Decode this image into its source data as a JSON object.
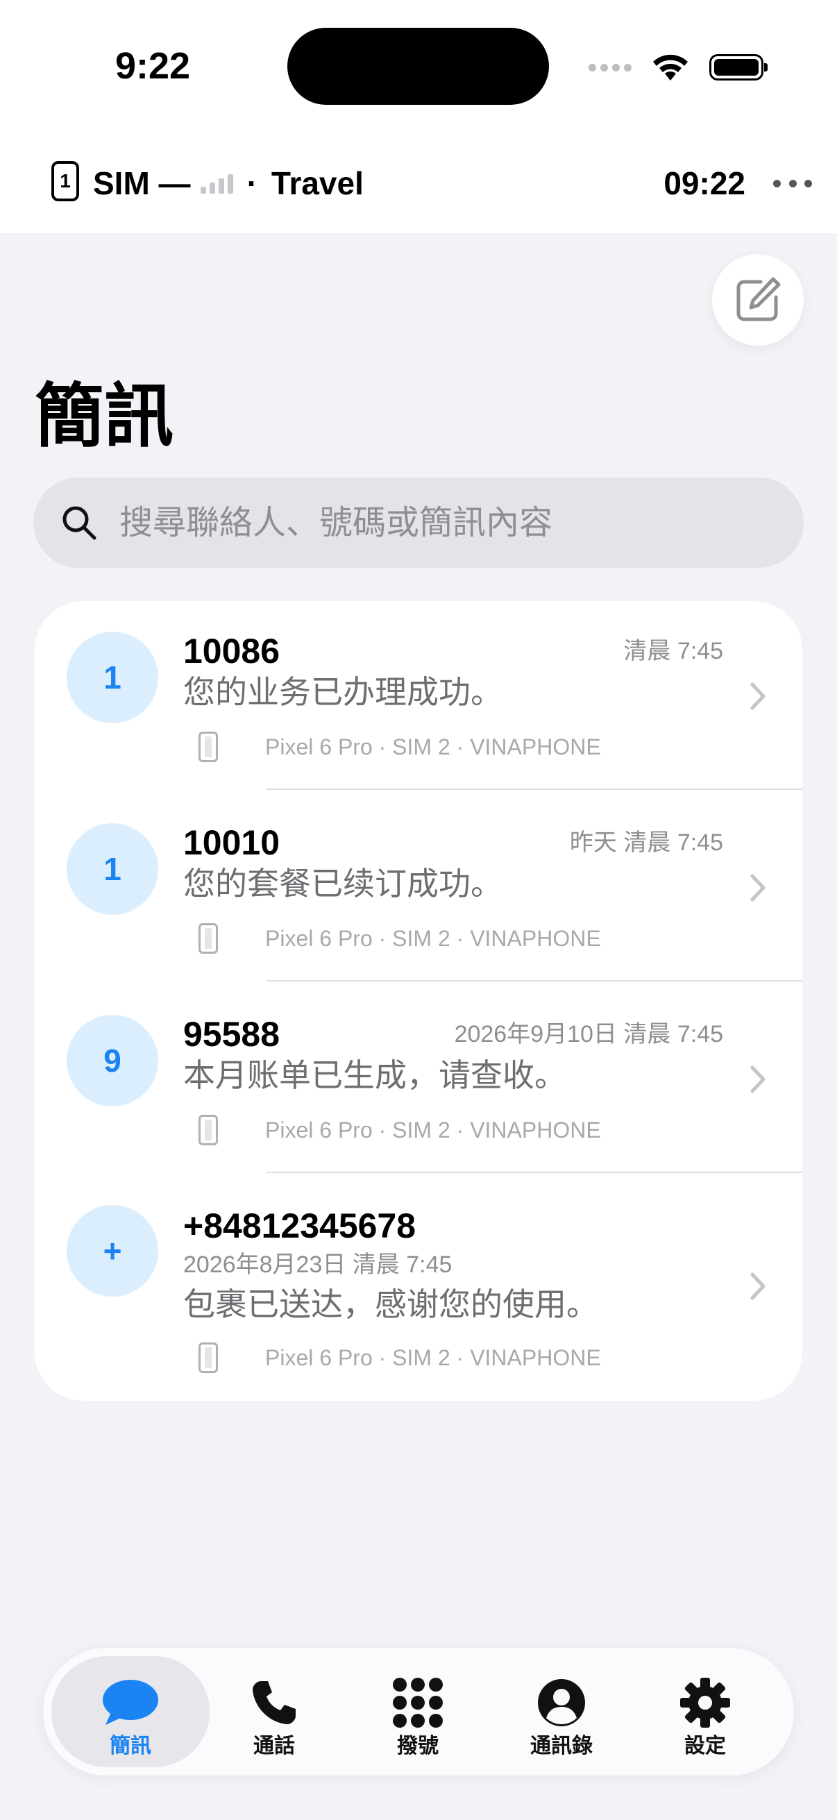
{
  "status_bar": {
    "time": "9:22"
  },
  "sim_bar": {
    "sim_slot": "1",
    "text": "SIM —",
    "dot": "·",
    "carrier": "Travel",
    "time": "09:22"
  },
  "header": {
    "title": "簡訊"
  },
  "search": {
    "placeholder": "搜尋聯絡人、號碼或簡訊內容"
  },
  "messages": [
    {
      "avatar": "1",
      "sender": "10086",
      "time": "清晨 7:45",
      "preview": "您的业务已办理成功。",
      "meta": "Pixel 6 Pro · SIM 2 · VINAPHONE"
    },
    {
      "avatar": "1",
      "sender": "10010",
      "time": "昨天 清晨 7:45",
      "preview": "您的套餐已续订成功。",
      "meta": "Pixel 6 Pro · SIM 2 · VINAPHONE"
    },
    {
      "avatar": "9",
      "sender": "95588",
      "time": "2026年9月10日 清晨 7:45",
      "preview": "本月账单已生成，请查收。",
      "meta": "Pixel 6 Pro · SIM 2 · VINAPHONE"
    },
    {
      "avatar": "+",
      "sender": "+84812345678",
      "time": "2026年8月23日 清晨 7:45",
      "preview": "包裹已送达，感谢您的使用。",
      "meta": "Pixel 6 Pro · SIM 2 · VINAPHONE"
    }
  ],
  "tabs": [
    {
      "label": "簡訊",
      "icon": "message-bubble-icon",
      "active": true
    },
    {
      "label": "通話",
      "icon": "phone-icon",
      "active": false
    },
    {
      "label": "撥號",
      "icon": "keypad-icon",
      "active": false
    },
    {
      "label": "通訊錄",
      "icon": "contact-icon",
      "active": false
    },
    {
      "label": "設定",
      "icon": "gear-icon",
      "active": false
    }
  ],
  "colors": {
    "accent": "#1c84f2",
    "avatar_bg": "#dbeefe",
    "background": "#f2f2f7"
  }
}
